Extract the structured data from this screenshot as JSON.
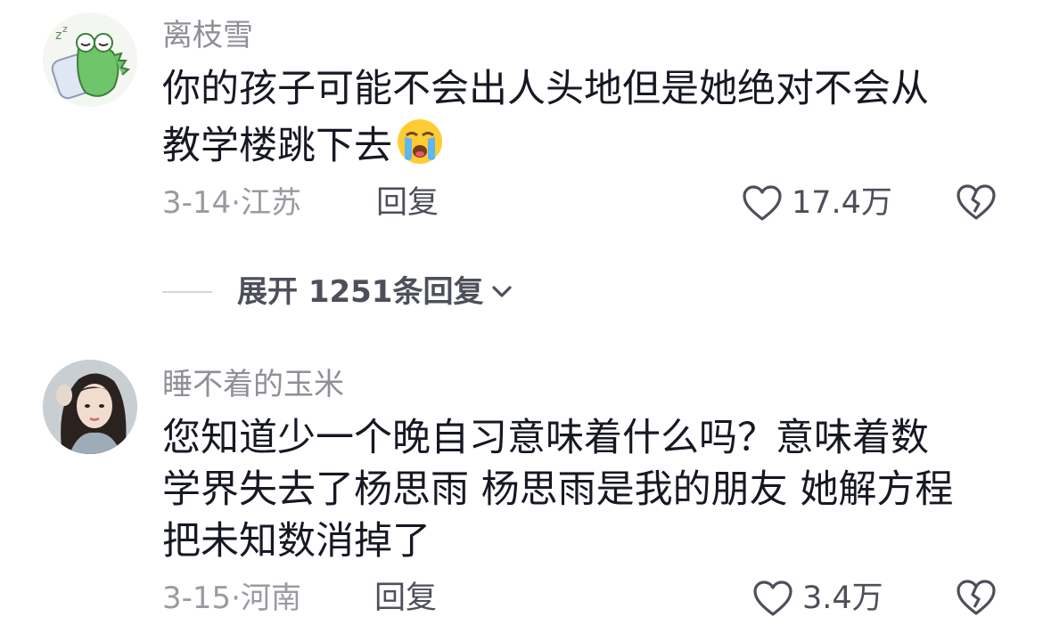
{
  "comments": [
    {
      "username": "离枝雪",
      "lines": [
        "你的孩子可能不会出人头地但是她绝对不会从",
        "教学楼跳下去"
      ],
      "emoji": "loudly-crying-face-emoji",
      "date": "3-14",
      "location": "江苏",
      "reply_label": "回复",
      "likes": "17.4万",
      "avatar_icon": "crocodile-avatar"
    },
    {
      "username": "睡不着的玉米",
      "lines": [
        "您知道少一个晚自习意味着什么吗？意味着数",
        "学界失去了杨思雨 杨思雨是我的朋友 她解方程",
        "把未知数消掉了"
      ],
      "date": "3-15",
      "location": "河南",
      "reply_label": "回复",
      "likes": "3.4万",
      "avatar_icon": "girl-photo-avatar"
    }
  ],
  "expand_replies": {
    "label": "展开 1251条回复"
  },
  "colors": {
    "text_primary": "#161823",
    "text_secondary": "#8f8f97",
    "icon": "#4d4f5a",
    "background": "#ffffff"
  }
}
